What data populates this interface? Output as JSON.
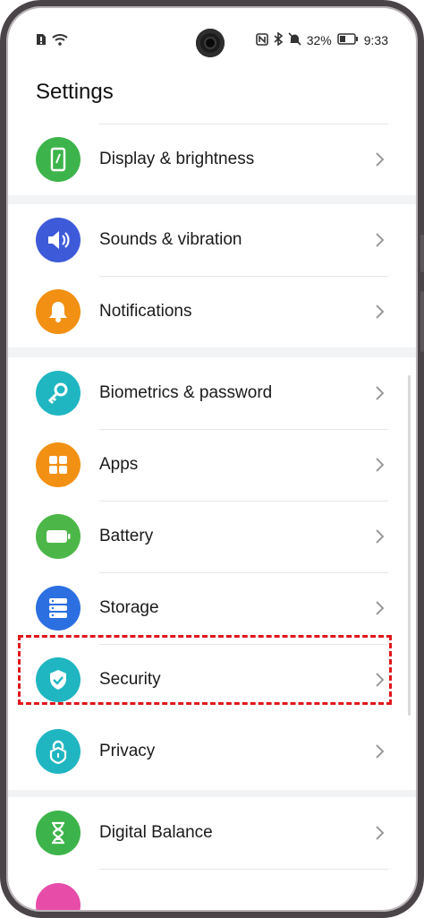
{
  "status_bar": {
    "battery_percent": "32%",
    "time": "9:33",
    "left_icons": [
      "sim-alert-icon",
      "wifi-icon"
    ],
    "right_icons": [
      "nfc-icon",
      "bluetooth-icon",
      "mute-icon",
      "battery-icon"
    ]
  },
  "header": {
    "title": "Settings"
  },
  "groups": [
    {
      "items": [
        {
          "label": "Display & brightness",
          "icon": "phone-display-icon",
          "color": "#3db44b"
        }
      ]
    },
    {
      "items": [
        {
          "label": "Sounds & vibration",
          "icon": "speaker-icon",
          "color": "#3d5bd9"
        },
        {
          "label": "Notifications",
          "icon": "bell-icon",
          "color": "#f29013"
        }
      ]
    },
    {
      "items": [
        {
          "label": "Biometrics & password",
          "icon": "key-icon",
          "color": "#1fb6c1"
        },
        {
          "label": "Apps",
          "icon": "apps-grid-icon",
          "color": "#f29013"
        },
        {
          "label": "Battery",
          "icon": "battery-icon",
          "color": "#4cb748"
        },
        {
          "label": "Storage",
          "icon": "storage-icon",
          "color": "#2c6fe0"
        },
        {
          "label": "Security",
          "icon": "shield-check-icon",
          "color": "#1fb6c1"
        },
        {
          "label": "Privacy",
          "icon": "lock-icon",
          "color": "#1fb6c1"
        }
      ]
    },
    {
      "items": [
        {
          "label": "Digital Balance",
          "icon": "hourglass-icon",
          "color": "#3db44b"
        }
      ]
    }
  ],
  "highlighted_item": "Security"
}
